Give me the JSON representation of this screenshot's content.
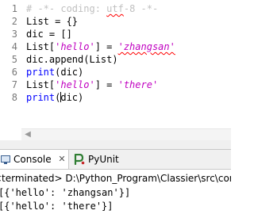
{
  "editor": {
    "line_numbers": [
      "1",
      "2",
      "3",
      "4",
      "5",
      "6",
      "7",
      "8"
    ],
    "lines": {
      "l1": {
        "comment": "# -*- coding: ",
        "squiggle_word": "utf",
        "rest": "-8 -*-"
      },
      "l2": {
        "code": "List = {}"
      },
      "l3": {
        "code": "dic = []"
      },
      "l4": {
        "prefix": "List[",
        "key": "'hello'",
        "mid": "] = ",
        "value": "'zhangsan'"
      },
      "l5": {
        "code": "dic.append(List)"
      },
      "l6": {
        "keyword": "print",
        "rest": "(dic)"
      },
      "l7": {
        "prefix": "List[",
        "key": "'hello'",
        "mid": "] = ",
        "value": "'there'"
      },
      "l8": {
        "keyword": "print",
        "paren": "(",
        "rest": "dic)"
      }
    },
    "scroll_left_icon": "arrow-left-icon"
  },
  "views": {
    "tabs": [
      {
        "label": "Console",
        "icon": "console-icon",
        "active": true
      },
      {
        "label": "PyUnit",
        "icon": "pyunit-icon",
        "active": false
      }
    ],
    "close_glyph": "✕"
  },
  "console": {
    "status_line": "<terminated> D:\\Python_Program\\Classier\\src\\com",
    "output": [
      "[{'hello': 'zhangsan'}]",
      "[{'hello': 'there'}]"
    ]
  },
  "colors": {
    "comment": "#c0c0c0",
    "string": "#c000c0",
    "keyword": "#0000ff",
    "line_number": "#787878",
    "squiggle": "#ff0000",
    "tab_bar": "#f0f0f0"
  }
}
